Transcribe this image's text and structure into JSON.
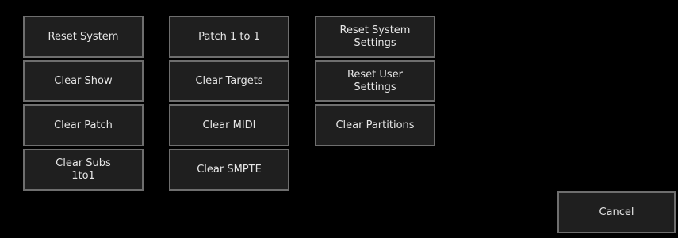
{
  "buttons": {
    "reset_system": "Reset System",
    "clear_show": "Clear Show",
    "clear_patch": "Clear Patch",
    "clear_subs_line1": "Clear Subs",
    "clear_subs_line2": "1to1",
    "patch_1_to_1": "Patch 1 to 1",
    "clear_targets": "Clear Targets",
    "clear_midi": "Clear MIDI",
    "clear_smpte": "Clear SMPTE",
    "reset_system_settings_line1": "Reset System",
    "reset_system_settings_line2": "Settings",
    "reset_user_settings_line1": "Reset User",
    "reset_user_settings_line2": "Settings",
    "clear_partitions": "Clear Partitions",
    "cancel": "Cancel"
  },
  "colors": {
    "background": "#000000",
    "button_fill": "#1f1f1f",
    "button_border": "#6e6e6e",
    "button_text": "#e6e6e6"
  }
}
